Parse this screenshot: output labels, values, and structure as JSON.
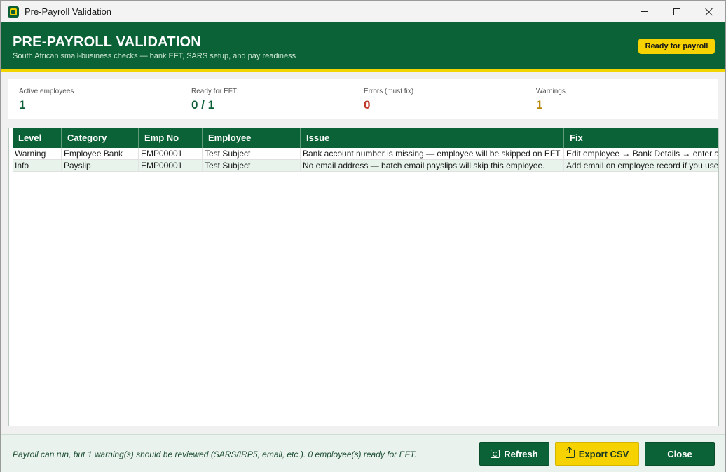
{
  "window": {
    "title": "Pre-Payroll Validation"
  },
  "header": {
    "title": "PRE-PAYROLL VALIDATION",
    "subtitle": "South African small-business checks — bank EFT, SARS setup, and pay readiness",
    "badge": "Ready for payroll"
  },
  "colors": {
    "brand_green": "#0b6236",
    "accent_yellow": "#f6d300",
    "error_red": "#c0392b",
    "warning_amber": "#b8860b"
  },
  "stats": [
    {
      "label": "Active employees",
      "value": "1",
      "color": "#0b5e35"
    },
    {
      "label": "Ready for EFT",
      "value": "0 / 1",
      "color": "#0b5e35"
    },
    {
      "label": "Errors (must fix)",
      "value": "0",
      "color": "#c0392b"
    },
    {
      "label": "Warnings",
      "value": "1",
      "color": "#b8860b"
    }
  ],
  "table": {
    "columns": [
      "Level",
      "Category",
      "Emp No",
      "Employee",
      "Issue",
      "Fix"
    ],
    "rows": [
      [
        "Warning",
        "Employee Bank",
        "EMP00001",
        "Test Subject",
        "Bank account number is missing — employee will be skipped on EFT e",
        "Edit employee → Bank Details → enter ac"
      ],
      [
        "Info",
        "Payslip",
        "EMP00001",
        "Test Subject",
        "No email address — batch email payslips will skip this employee.",
        "Add email on employee record if you use"
      ]
    ]
  },
  "footer": {
    "message": "Payroll can run, but 1 warning(s) should be reviewed (SARS/IRP5, email, etc.). 0 employee(s) ready for EFT.",
    "buttons": {
      "refresh": "Refresh",
      "export": "Export CSV",
      "close": "Close"
    }
  }
}
